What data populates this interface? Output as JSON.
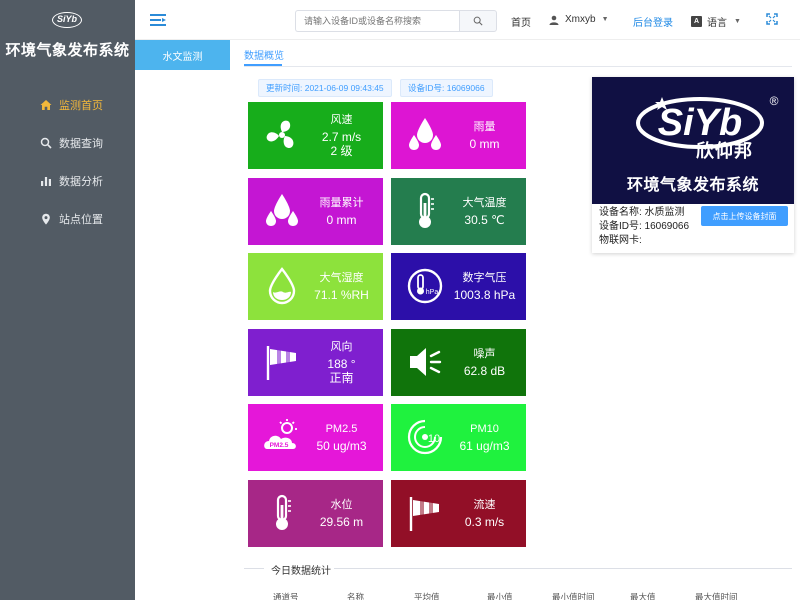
{
  "sidebar": {
    "logo_text": "SiYb",
    "title": "环境气象发布系统",
    "items": [
      {
        "label": "监测首页",
        "icon": "home-icon",
        "active": true
      },
      {
        "label": "数据查询",
        "icon": "search-icon",
        "active": false
      },
      {
        "label": "数据分析",
        "icon": "bar-chart-icon",
        "active": false
      },
      {
        "label": "站点位置",
        "icon": "location-pin-icon",
        "active": false
      }
    ]
  },
  "topbar": {
    "search_placeholder": "请输入设备ID或设备名称搜索",
    "home_label": "首页",
    "user_label": "Xmxyb",
    "admin_label": "后台登录",
    "lang_label": "语言",
    "lang_icon_text": "A"
  },
  "tabs": {
    "left_tab": "水文监测",
    "content_tab": "数据概览"
  },
  "info": {
    "update_time": "更新时间: 2021-06-09 09:43:45",
    "device_id": "设备ID号: 16069066"
  },
  "tiles": [
    {
      "label": "风速",
      "value": "2.7 m/s",
      "value2": "2 级",
      "color": "#17ad1b",
      "icon": "fan-icon"
    },
    {
      "label": "雨量",
      "value": "0 mm",
      "value2": "",
      "color": "#dd15d3",
      "icon": "raindrops-icon"
    },
    {
      "label": "雨量累计",
      "value": "0 mm",
      "value2": "",
      "color": "#c416d3",
      "icon": "raindrops-icon"
    },
    {
      "label": "大气温度",
      "value": "30.5 ℃",
      "value2": "",
      "color": "#247d4e",
      "icon": "thermometer-icon"
    },
    {
      "label": "大气湿度",
      "value": "71.1 %RH",
      "value2": "",
      "color": "#8de23c",
      "icon": "humidity-drop-icon"
    },
    {
      "label": "数字气压",
      "value": "1003.8 hPa",
      "value2": "",
      "color": "#2c0fa9",
      "icon": "pressure-gauge-icon"
    },
    {
      "label": "风向",
      "value": "188 °",
      "value2": "正南",
      "color": "#7f1fcf",
      "icon": "windsock-icon"
    },
    {
      "label": "噪声",
      "value": "62.8 dB",
      "value2": "",
      "color": "#10740b",
      "icon": "speaker-icon"
    },
    {
      "label": "PM2.5",
      "value": "50 ug/m3",
      "value2": "",
      "color": "#e517d9",
      "icon": "pm25-cloud-icon"
    },
    {
      "label": "PM10",
      "value": "61 ug/m3",
      "value2": "",
      "color": "#1ff23e",
      "icon": "pm10-icon"
    },
    {
      "label": "水位",
      "value": "29.56 m",
      "value2": "",
      "color": "#a72787",
      "icon": "thermometer-icon"
    },
    {
      "label": "流速",
      "value": "0.3 m/s",
      "value2": "",
      "color": "#920f27",
      "icon": "windsock-icon"
    }
  ],
  "device_card": {
    "logo_text": "SiYb",
    "registered_mark": "®",
    "brand_cn": "欣仰邦",
    "system_name": "环境气象发布系统",
    "name_row": "设备名称: 水质监测",
    "id_row": "设备ID号: 16069066",
    "iot_row": "物联网卡:",
    "upload_button": "点击上传设备封面"
  },
  "stats": {
    "title": "今日数据统计",
    "headers": [
      "通道号",
      "名称",
      "平均值",
      "最小值",
      "最小值时间",
      "最大值",
      "最大值时间"
    ]
  }
}
